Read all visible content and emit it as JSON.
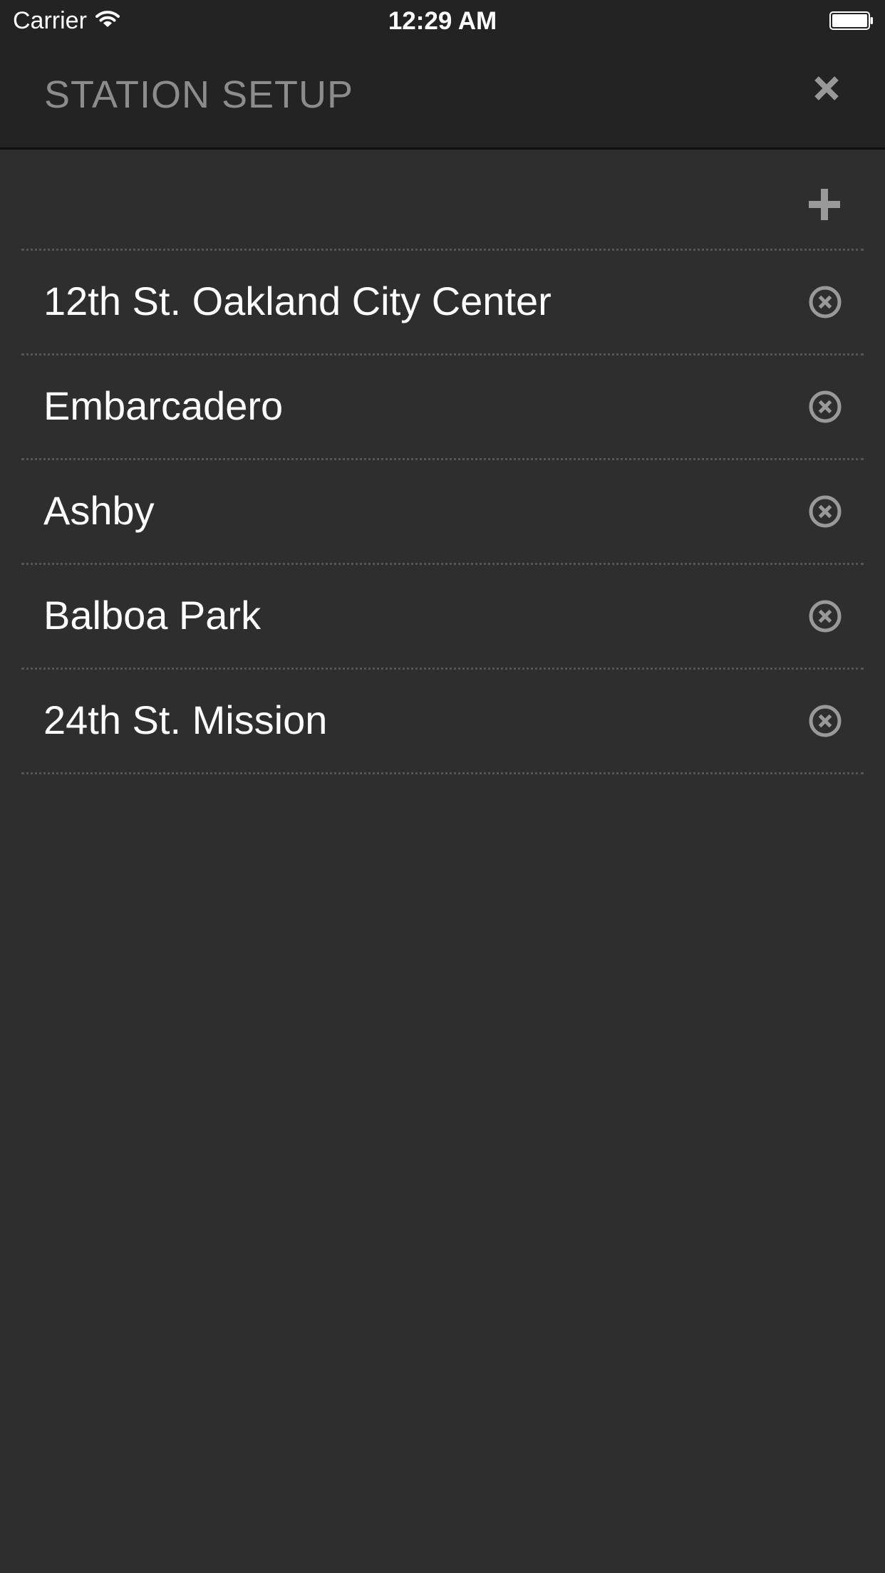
{
  "status_bar": {
    "carrier": "Carrier",
    "time": "12:29 AM",
    "icons": [
      "wifi-icon",
      "battery-icon"
    ]
  },
  "header": {
    "title": "STATION SETUP",
    "close_icon": "close-icon"
  },
  "toolbar": {
    "add_icon": "plus-icon"
  },
  "stations": [
    {
      "name": "12th St. Oakland City Center",
      "remove_icon": "remove-circle-icon"
    },
    {
      "name": "Embarcadero",
      "remove_icon": "remove-circle-icon"
    },
    {
      "name": "Ashby",
      "remove_icon": "remove-circle-icon"
    },
    {
      "name": "Balboa Park",
      "remove_icon": "remove-circle-icon"
    },
    {
      "name": "24th St. Mission",
      "remove_icon": "remove-circle-icon"
    }
  ],
  "colors": {
    "background": "#2e2e2e",
    "header_background": "#232323",
    "title_text": "#8c8c8c",
    "icon_gray": "#999999",
    "row_text": "#ffffff",
    "divider": "#555555"
  }
}
